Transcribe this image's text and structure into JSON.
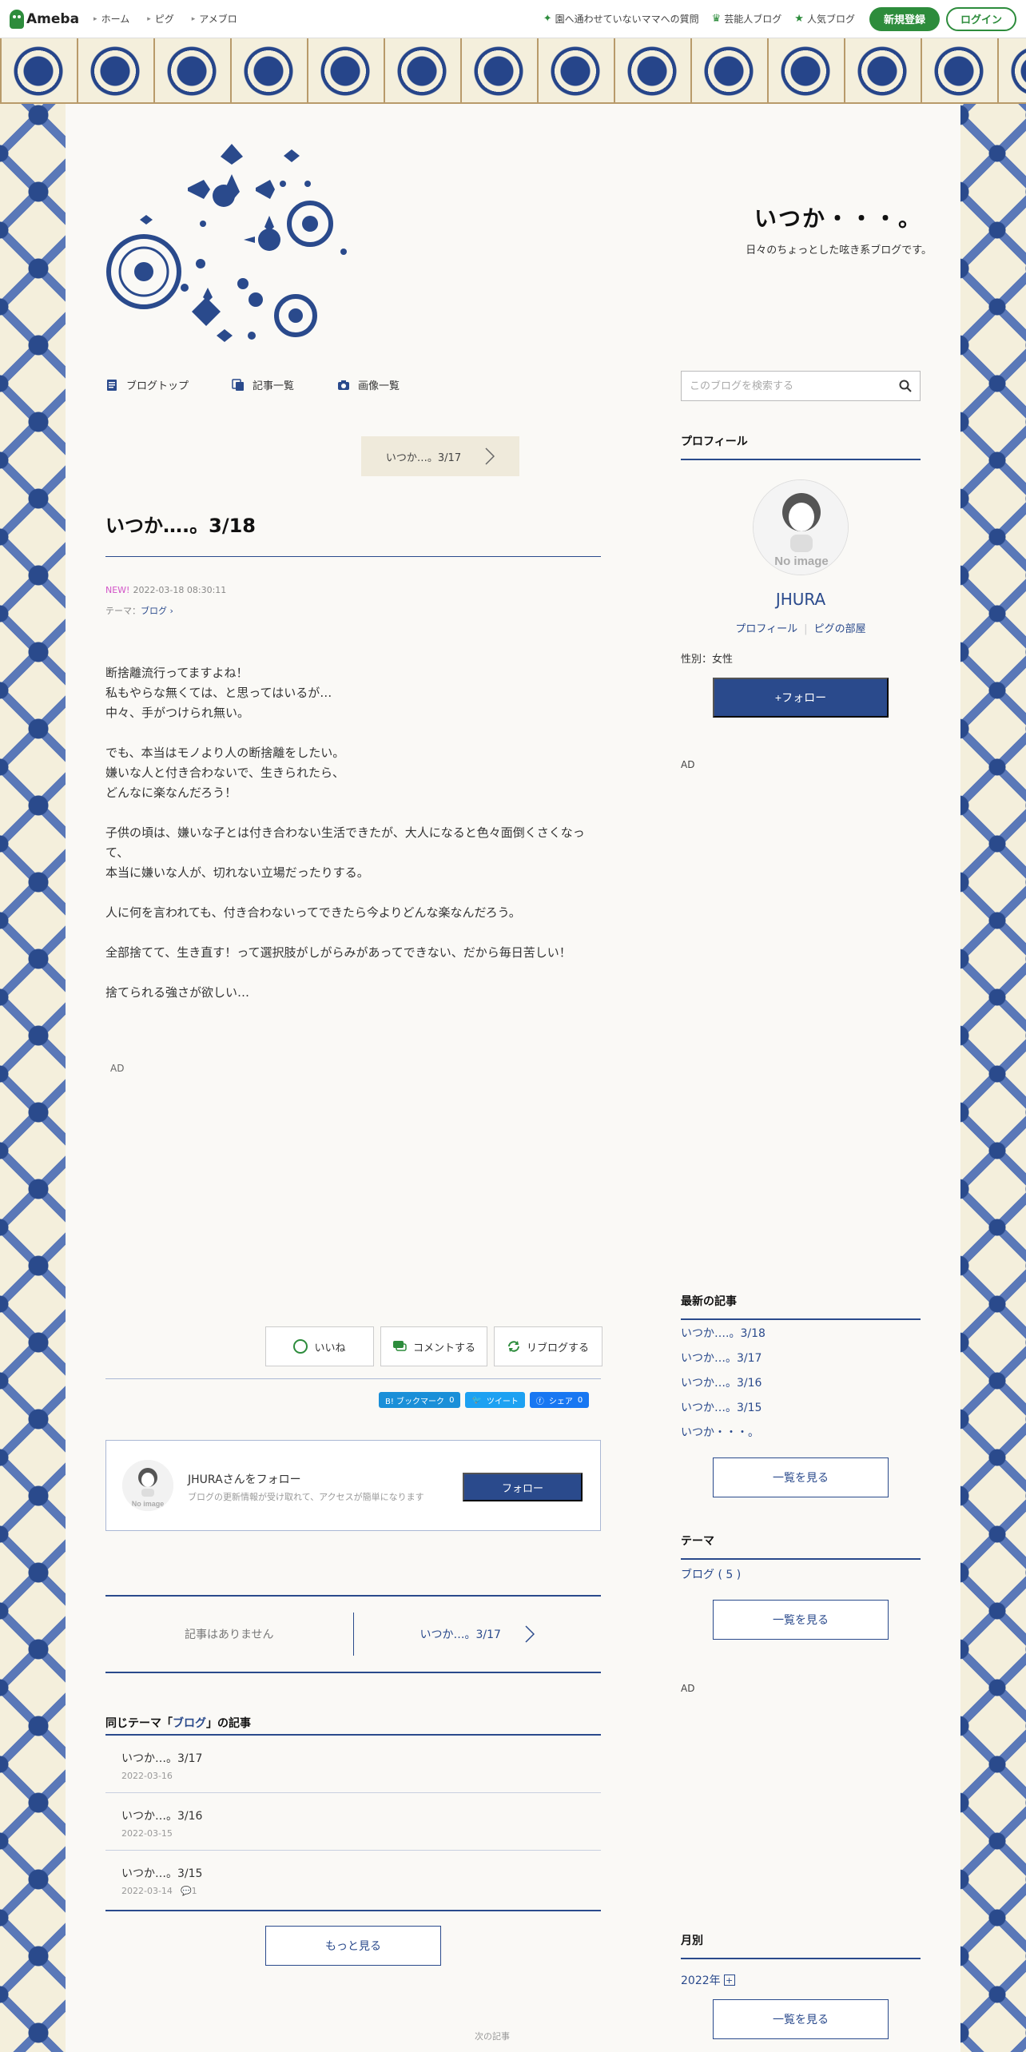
{
  "topbar": {
    "logo": "Ameba",
    "nav": [
      "ホーム",
      "ピグ",
      "アメブロ"
    ],
    "links": [
      "園へ通わせていないママへの質問",
      "芸能人ブログ",
      "人気ブログ"
    ],
    "register": "新規登録",
    "login": "ログイン"
  },
  "header": {
    "title": "いつか・・・。",
    "description": "日々のちょっとした呟き系ブログです。"
  },
  "blog_nav": [
    "ブログトップ",
    "記事一覧",
    "画像一覧"
  ],
  "search": {
    "placeholder": "このブログを検索する"
  },
  "pager_top": {
    "prev_label": "いつか…。3/17"
  },
  "article": {
    "title": "いつか….。3/18",
    "new_badge": "NEW!",
    "datetime": "2022-03-18 08:30:11",
    "theme_prefix": "テーマ：",
    "theme": "ブログ",
    "paragraphs": [
      "断捨離流行ってますよね！\n私もやらな無くては、と思ってはいるが…\n中々、手がつけられ無い。",
      "でも、本当はモノより人の断捨離をしたい。\n嫌いな人と付き合わないで、生きられたら、\nどんなに楽なんだろう！",
      "子供の頃は、嫌いな子とは付き合わない生活できたが、大人になると色々面倒くさくなって、\n本当に嫌いな人が、切れない立場だったりする。",
      "人に何を言われても、付き合わないってできたら今よりどんな楽なんだろう。",
      "全部捨てて、生き直す！って選択肢がしがらみがあってできない、だから毎日苦しい！",
      "捨てられる強さが欲しい…"
    ],
    "ad_label": "AD"
  },
  "actions": {
    "like": "いいね",
    "comment": "コメントする",
    "reblog": "リブログする"
  },
  "share": {
    "hatena": "B! ブックマーク",
    "hatena_count": "0",
    "tweet": "ツイート",
    "facebook": "シェア",
    "facebook_count": "0"
  },
  "follow_box": {
    "name": "JHURAさんをフォロー",
    "sub": "ブログの更新情報が受け取れて、アクセスが簡単になります",
    "button": "フォロー",
    "noimage": "No image"
  },
  "pager_bottom": {
    "prev": "記事はありません",
    "next": "いつか…。3/17"
  },
  "same_theme": {
    "title_before": "同じテーマ「",
    "theme": "ブログ",
    "title_after": "」の記事",
    "items": [
      {
        "title": "いつか…。3/17",
        "date": "2022-03-16",
        "comments": ""
      },
      {
        "title": "いつか…。3/16",
        "date": "2022-03-15",
        "comments": ""
      },
      {
        "title": "いつか…。3/15",
        "date": "2022-03-14",
        "comments": "1"
      }
    ],
    "more": "もっと見る"
  },
  "next_article_label": "次の記事",
  "sidebar": {
    "profile_head": "プロフィール",
    "noimage": "No image",
    "name": "JHURA",
    "profile_link": "プロフィール",
    "pig_link": "ピグの部屋",
    "gender": "性別：女性",
    "follow": "+フォロー",
    "ad1": "AD",
    "recent_head": "最新の記事",
    "recent": [
      "いつか….。3/18",
      "いつか…。3/17",
      "いつか…。3/16",
      "いつか…。3/15",
      "いつか・・・。"
    ],
    "recent_more": "一覧を見る",
    "theme_head": "テーマ",
    "theme_item": "ブログ ( 5 )",
    "theme_more": "一覧を見る",
    "ad2": "AD",
    "monthly_head": "月別",
    "month": "2022年",
    "monthly_more": "一覧を見る"
  },
  "colors": {
    "brand_green": "#2d8c3c",
    "accent_blue": "#2a4a8c",
    "new_pink": "#d254c8"
  }
}
